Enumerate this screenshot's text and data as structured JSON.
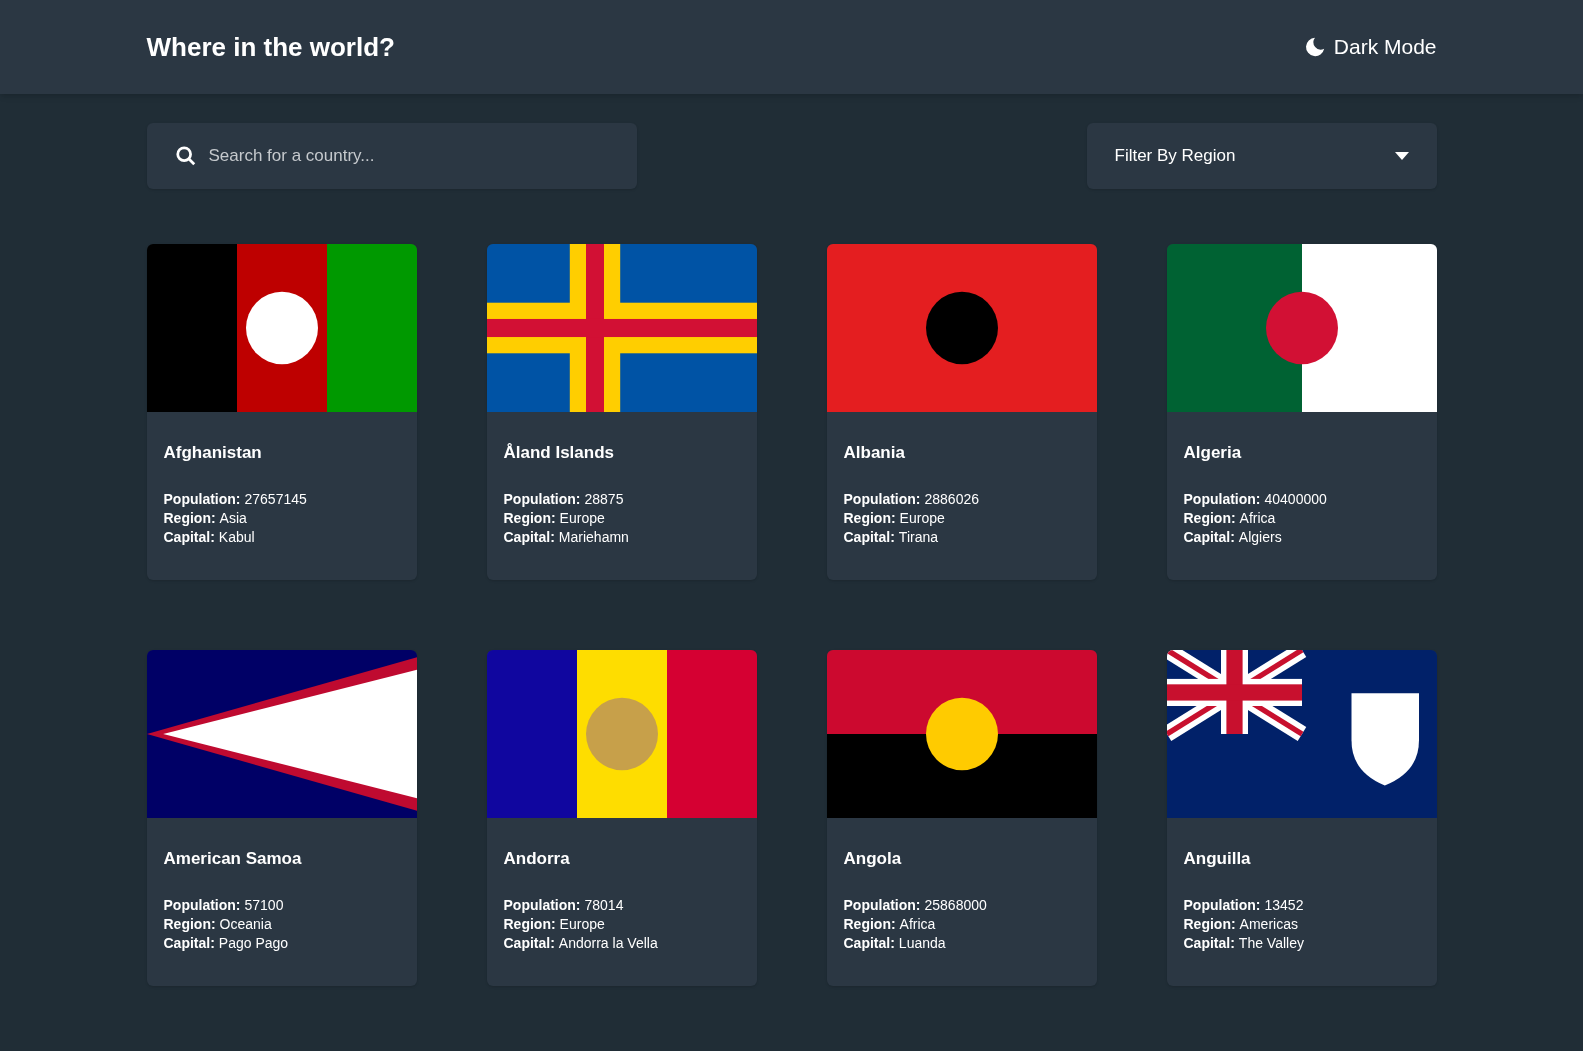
{
  "header": {
    "title": "Where in the world?",
    "theme_toggle": "Dark Mode"
  },
  "search": {
    "placeholder": "Search for a country..."
  },
  "filter": {
    "label": "Filter By Region"
  },
  "countries": [
    {
      "name": "Afghanistan",
      "details": [
        {
          "label": "Population:",
          "value": "27657145"
        },
        {
          "label": "Region:",
          "value": "Asia"
        },
        {
          "label": "Capital:",
          "value": "Kabul"
        }
      ]
    },
    {
      "name": "Åland Islands",
      "details": [
        {
          "label": "Population:",
          "value": "28875"
        },
        {
          "label": "Region:",
          "value": "Europe"
        },
        {
          "label": "Capital:",
          "value": "Mariehamn"
        }
      ]
    },
    {
      "name": "Albania",
      "details": [
        {
          "label": "Population:",
          "value": "2886026"
        },
        {
          "label": "Region:",
          "value": "Europe"
        },
        {
          "label": "Capital:",
          "value": "Tirana"
        }
      ]
    },
    {
      "name": "Algeria",
      "details": [
        {
          "label": "Population:",
          "value": "40400000"
        },
        {
          "label": "Region:",
          "value": "Africa"
        },
        {
          "label": "Capital:",
          "value": "Algiers"
        }
      ]
    },
    {
      "name": "American Samoa",
      "details": [
        {
          "label": "Population:",
          "value": "57100"
        },
        {
          "label": "Region:",
          "value": "Oceania"
        },
        {
          "label": "Capital:",
          "value": "Pago Pago"
        }
      ]
    },
    {
      "name": "Andorra",
      "details": [
        {
          "label": "Population:",
          "value": "78014"
        },
        {
          "label": "Region:",
          "value": "Europe"
        },
        {
          "label": "Capital:",
          "value": "Andorra la Vella"
        }
      ]
    },
    {
      "name": "Angola",
      "details": [
        {
          "label": "Population:",
          "value": "25868000"
        },
        {
          "label": "Region:",
          "value": "Africa"
        },
        {
          "label": "Capital:",
          "value": "Luanda"
        }
      ]
    },
    {
      "name": "Anguilla",
      "details": [
        {
          "label": "Population:",
          "value": "13452"
        },
        {
          "label": "Region:",
          "value": "Americas"
        },
        {
          "label": "Capital:",
          "value": "The Valley"
        }
      ]
    }
  ]
}
